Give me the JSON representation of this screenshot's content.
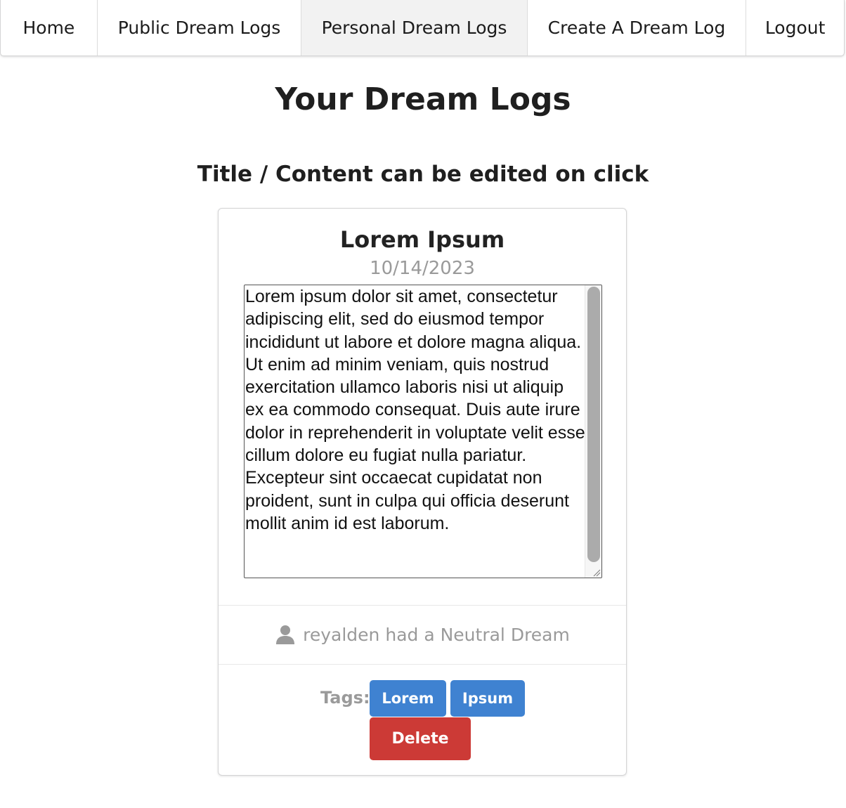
{
  "nav": {
    "items": [
      {
        "label": "Home"
      },
      {
        "label": "Public Dream Logs"
      },
      {
        "label": "Personal Dream Logs"
      },
      {
        "label": "Create A Dream Log"
      },
      {
        "label": "Logout"
      }
    ],
    "active": "Personal Dream Logs"
  },
  "page": {
    "title": "Your Dream Logs",
    "subtitle": "Title / Content can be edited on click"
  },
  "dream_log": {
    "title": "Lorem Ipsum",
    "date": "10/14/2023",
    "content": "Lorem ipsum dolor sit amet, consectetur adipiscing elit, sed do eiusmod tempor incididunt ut labore et dolore magna aliqua. Ut enim ad minim veniam, quis nostrud exercitation ullamco laboris nisi ut aliquip ex ea commodo consequat. Duis aute irure dolor in reprehenderit in voluptate velit esse cillum dolore eu fugiat nulla pariatur. Excepteur sint occaecat cupidatat non proident, sunt in culpa qui officia deserunt mollit anim id est laborum.",
    "author_line": "reyalden had a Neutral Dream",
    "author_icon": "user-icon",
    "tags_label": "Tags:",
    "tags": [
      "Lorem",
      "Ipsum"
    ],
    "delete_label": "Delete"
  },
  "colors": {
    "tag": "#3f82d1",
    "delete": "#cc3a36",
    "muted_text": "#9a9a9a"
  }
}
